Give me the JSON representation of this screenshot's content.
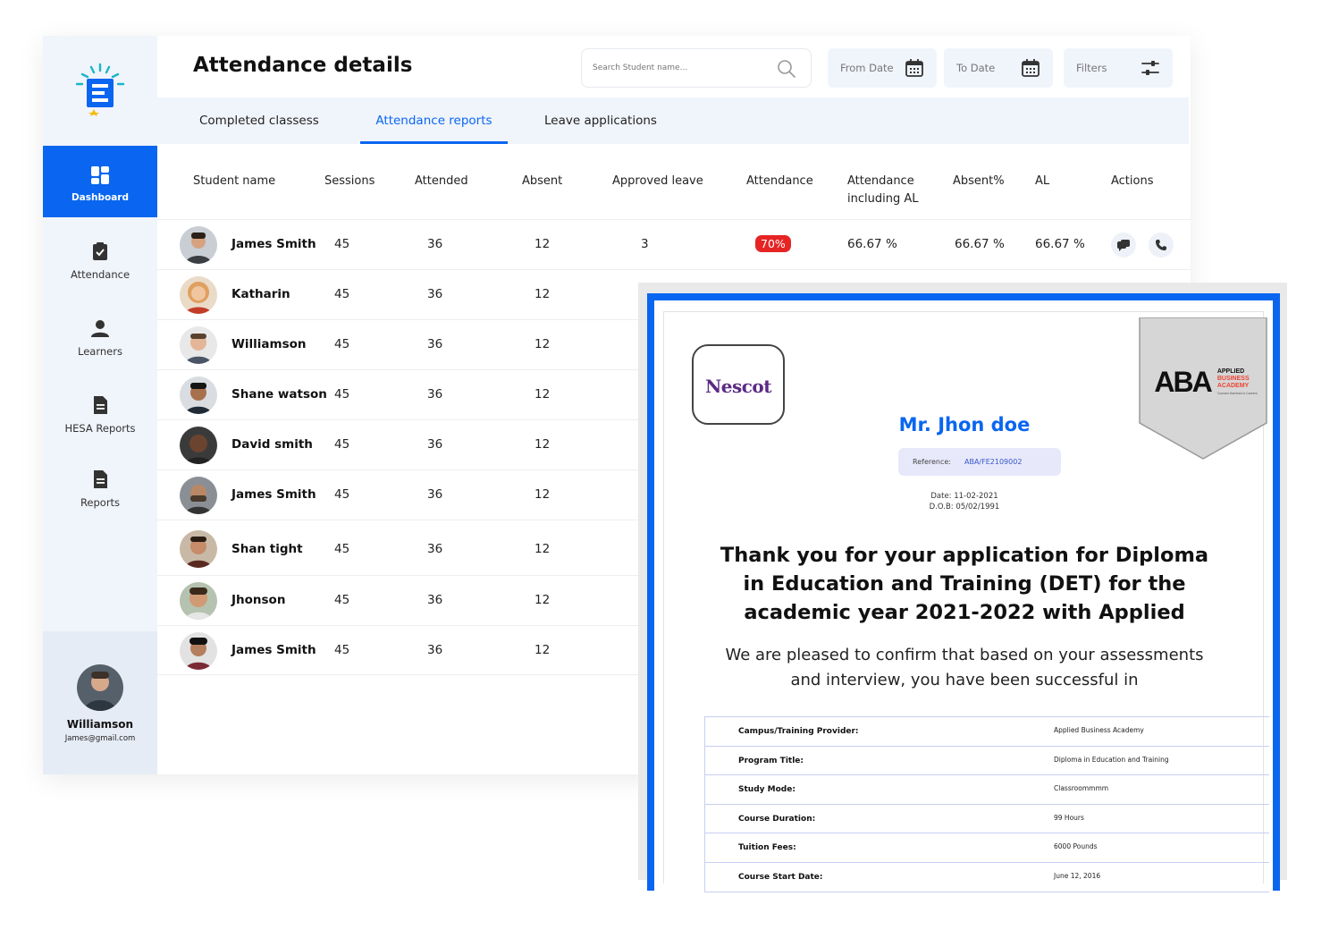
{
  "sidebar": {
    "items": [
      {
        "label": "Dashboard",
        "icon": "dashboard-icon",
        "active": true
      },
      {
        "label": "Attendance",
        "icon": "clipboard-icon"
      },
      {
        "label": "Learners",
        "icon": "user-icon"
      },
      {
        "label": "HESA Reports",
        "icon": "document-icon"
      },
      {
        "label": "Reports",
        "icon": "document-icon"
      }
    ],
    "profile": {
      "name": "Williamson",
      "email": "James@gmail.com"
    }
  },
  "header": {
    "title": "Attendance details",
    "search_placeholder": "Search Student name...",
    "from_date": "From Date",
    "to_date": "To Date",
    "filters": "Filters"
  },
  "tabs": [
    {
      "label": "Completed classess"
    },
    {
      "label": "Attendance reports",
      "active": true
    },
    {
      "label": "Leave applications"
    }
  ],
  "table": {
    "columns": [
      "Student name",
      "Sessions",
      "Attended",
      "Absent",
      "Approved leave",
      "Attendance",
      "Attendance including AL",
      "Absent%",
      "AL",
      "Actions"
    ],
    "rows": [
      {
        "name": "James Smith",
        "sessions": "45",
        "attended": "36",
        "absent": "12",
        "approved_leave": "3",
        "attendance": "70%",
        "attendance_incl_al": "66.67 %",
        "absent_pct": "66.67 %",
        "al": "66.67 %"
      },
      {
        "name": "Katharin",
        "sessions": "45",
        "attended": "36",
        "absent": "12"
      },
      {
        "name": "Williamson",
        "sessions": "45",
        "attended": "36",
        "absent": "12"
      },
      {
        "name": "Shane watson",
        "sessions": "45",
        "attended": "36",
        "absent": "12"
      },
      {
        "name": "David smith",
        "sessions": "45",
        "attended": "36",
        "absent": "12"
      },
      {
        "name": "James Smith",
        "sessions": "45",
        "attended": "36",
        "absent": "12"
      },
      {
        "name": "Shan tight",
        "sessions": "45",
        "attended": "36",
        "absent": "12"
      },
      {
        "name": "Jhonson",
        "sessions": "45",
        "attended": "36",
        "absent": "12"
      },
      {
        "name": "James Smith",
        "sessions": "45",
        "attended": "36",
        "absent": "12"
      }
    ]
  },
  "certificate": {
    "left_logo": "Nescot",
    "right_logo": {
      "mark": "ABA",
      "line1": "APPLIED",
      "line2": "BUSINESS",
      "line3": "ACADEMY",
      "tagline": "Courses that lead to Careers"
    },
    "recipient": "Mr. Jhon doe",
    "reference_label": "Reference:",
    "reference_value": "ABA/FE2109002",
    "date": "Date: 11-02-2021",
    "dob": "D.O.B:   05/02/1991",
    "heading": "Thank you for your application for Diploma in Education and Training (DET) for the academic year 2021-2022 with Applied",
    "body": "We are pleased to confirm that based on your assessments and interview, you have been successful in",
    "details": [
      {
        "label": "Campus/Training Provider:",
        "value": "Applied Business Academy"
      },
      {
        "label": "Program Title:",
        "value": "Diploma in Education and Training"
      },
      {
        "label": "Study Mode:",
        "value": "Classroommmm"
      },
      {
        "label": "Course Duration:",
        "value": "99 Hours"
      },
      {
        "label": "Tuition Fees:",
        "value": "6000 Pounds"
      },
      {
        "label": "Course Start Date:",
        "value": "June 12, 2016"
      }
    ]
  },
  "colors": {
    "accent": "#0a66f0",
    "sidebar_bg": "#f0f4fb",
    "badge_red": "#e62424",
    "nescot_purple": "#5b2a84"
  }
}
